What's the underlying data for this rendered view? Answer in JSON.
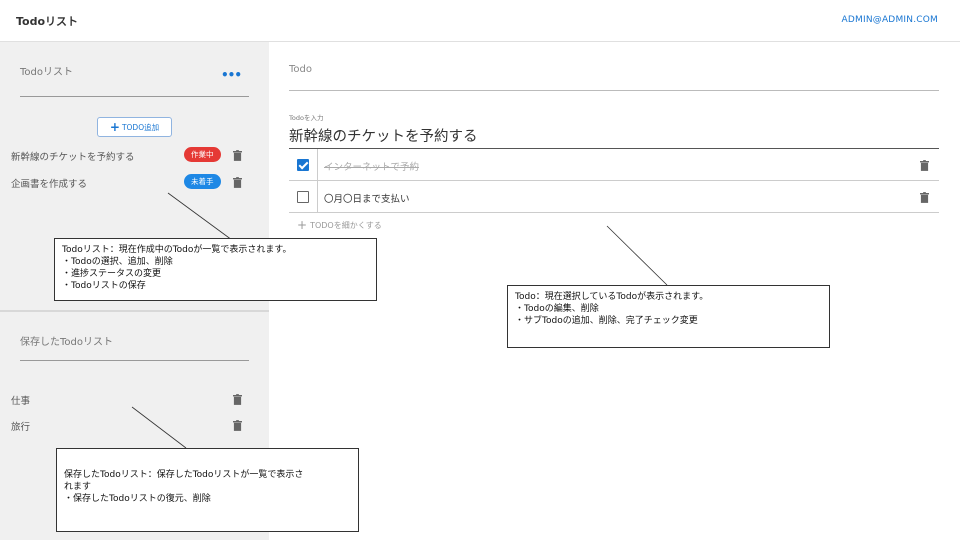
{
  "header": {
    "app_title": "Todoリスト",
    "user_email": "ADMIN@ADMIN.COM"
  },
  "sidebar": {
    "list_section_title": "Todoリスト",
    "add_button_label": "TODO追加",
    "lists": [
      {
        "label": "新幹線のチケットを予約する",
        "status": "作業中",
        "status_color": "#e53935"
      },
      {
        "label": "企画書を作成する",
        "status": "未着手",
        "status_color": "#1e88e5"
      }
    ],
    "saved_section_title": "保存したTodoリスト",
    "saved_lists": [
      {
        "label": "仕事"
      },
      {
        "label": "旅行"
      }
    ]
  },
  "main": {
    "title": "Todo",
    "input_label": "Todoを入力",
    "input_value": "新幹線のチケットを予約する",
    "subtodos": [
      {
        "label": "インターネットで予約",
        "done": true
      },
      {
        "label": "〇月〇日まで支払い",
        "done": false
      }
    ],
    "detail_button_label": "TODOを細かくする"
  },
  "annotations": {
    "list_note": [
      "Todoリスト：現在作成中のTodoが一覧で表示されます。",
      "・Todoの選択、追加、削除",
      "・進捗ステータスの変更",
      "・Todoリストの保存"
    ],
    "detail_note": [
      "Todo：現在選択しているTodoが表示されます。",
      "・Todoの編集、削除",
      "・サブTodoの追加、削除、完了チェック変更"
    ],
    "saved_note": [
      "保存したTodoリスト：保存したTodoリストが一覧で表示さ",
      "れます",
      "・保存したTodoリストの復元、削除"
    ]
  },
  "colors": {
    "accent": "#1976d2",
    "sidebar_bg": "#f0f0f0",
    "status_in_progress": "#e53935",
    "status_not_started": "#1e88e5"
  }
}
